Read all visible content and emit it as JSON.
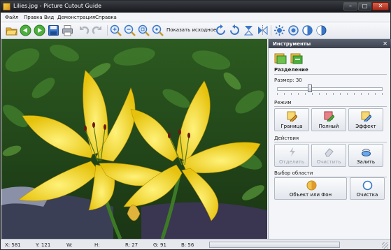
{
  "window": {
    "title": "Lilies.jpg - Picture Cutout Guide",
    "controls": {
      "minimize": "–",
      "maximize": "□",
      "close": "✕"
    }
  },
  "menu": [
    "Файл",
    "Правка",
    "Вид",
    "Демонстрация",
    "Справка"
  ],
  "toolbar": {
    "icons": [
      "open-folder-icon",
      "back-arrow-icon",
      "forward-arrow-icon",
      "save-icon",
      "print-icon",
      "undo-icon",
      "redo-icon",
      "zoom-in-icon",
      "zoom-out-icon",
      "zoom-fit-icon",
      "zoom-actual-icon",
      "rotate-right-icon",
      "rotate-left-icon",
      "flip-vertical-icon",
      "flip-horizontal-icon",
      "brightness-icon",
      "color-icon",
      "contrast-icon",
      "invert-icon"
    ],
    "show_original_label": "Показать исходное"
  },
  "tools_panel": {
    "title": "Инструменты",
    "close_glyph": "✕",
    "separation": {
      "title": "Разделение",
      "size_label": "Размер: 30",
      "size_value": 30,
      "size_max": 100
    },
    "mode": {
      "title": "Режим",
      "buttons": [
        {
          "label": "Граница",
          "icon": "border-brush-icon",
          "enabled": true
        },
        {
          "label": "Полный",
          "icon": "fill-brush-icon",
          "enabled": true
        },
        {
          "label": "Эффект",
          "icon": "effect-brush-icon",
          "enabled": true
        }
      ]
    },
    "actions": {
      "title": "Действия",
      "buttons": [
        {
          "label": "Отделить",
          "icon": "separate-icon",
          "enabled": false
        },
        {
          "label": "Очистить",
          "icon": "eraser-icon",
          "enabled": false
        },
        {
          "label": "Залить",
          "icon": "fill-bucket-icon",
          "enabled": true
        }
      ]
    },
    "selection": {
      "title": "Выбор области",
      "buttons": [
        {
          "label": "Объект или Фон",
          "icon": "object-background-icon"
        },
        {
          "label": "Очистка",
          "icon": "clear-selection-icon"
        }
      ]
    }
  },
  "status": {
    "x": "X: 581",
    "y": "Y: 121",
    "w": "W:",
    "h": "H:",
    "r": "R: 27",
    "g": "G: 91",
    "b": "B: 56",
    "progress": 0
  },
  "colors": {
    "petal": "#f5dc1a",
    "foliage": "#2d5a22",
    "accent": "#3b77c8"
  }
}
